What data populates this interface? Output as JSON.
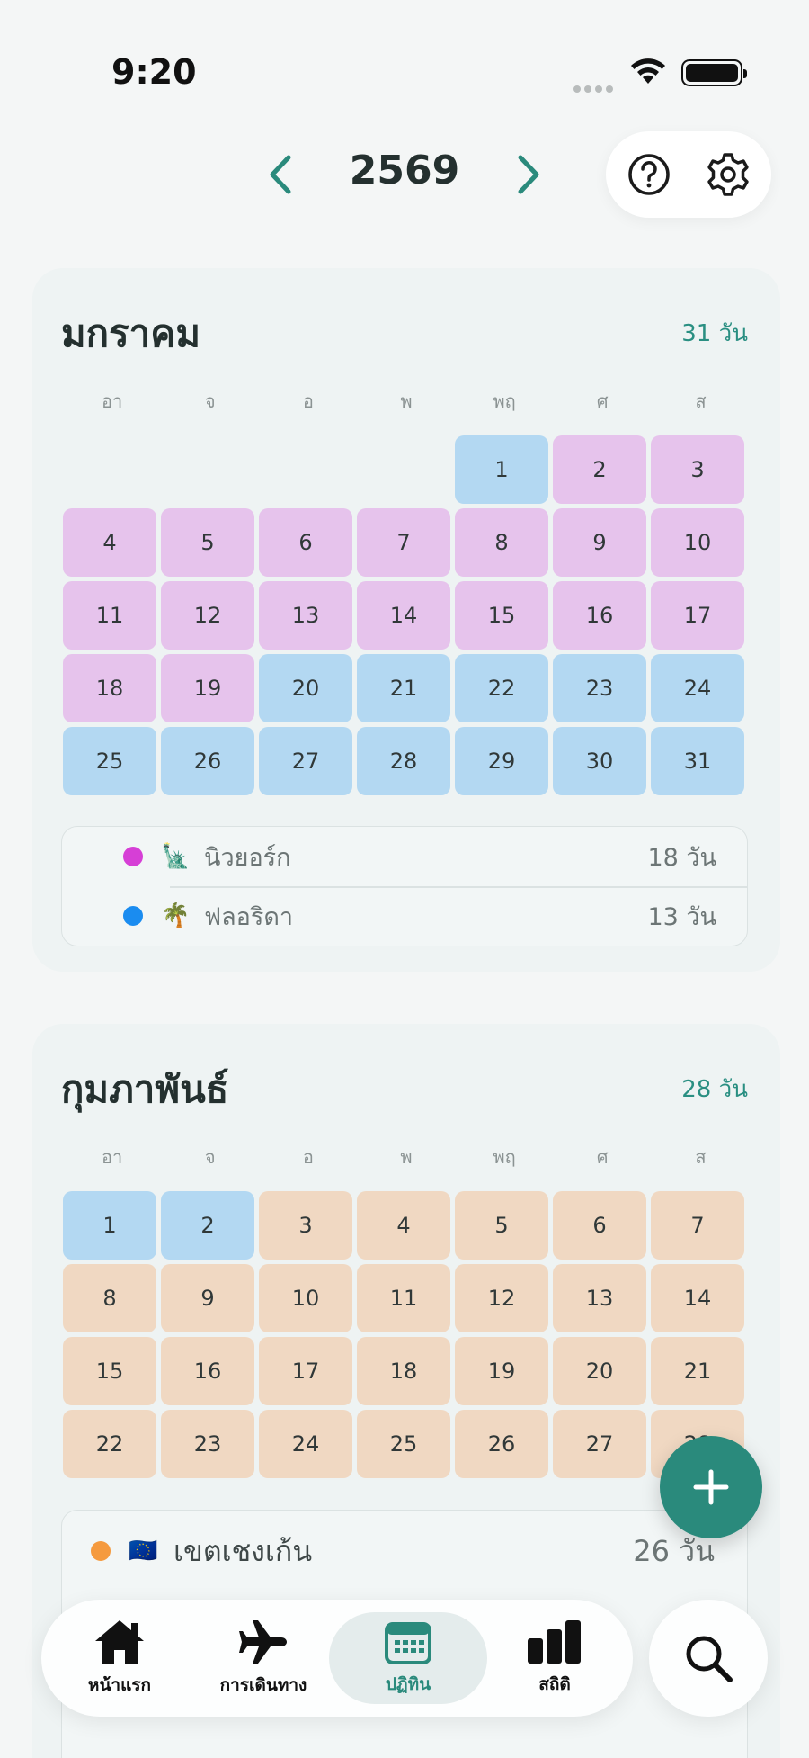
{
  "status_bar": {
    "time": "9:20"
  },
  "header": {
    "year": "2569"
  },
  "colors": {
    "accent": "#2a8a7c",
    "new_york": "#e6c3ec",
    "florida": "#b3d8f2",
    "schengen": "#f0d8c2"
  },
  "weekdays": [
    "อา",
    "จ",
    "อ",
    "พ",
    "พฤ",
    "ศ",
    "ส"
  ],
  "months": [
    {
      "name": "มกราคม",
      "count": "31 วัน",
      "legend": [
        {
          "name": "นิวยอร์ก",
          "emoji": "🗽",
          "days": "18 วัน",
          "dot": "#d63fd6"
        },
        {
          "name": "ฟลอริดา",
          "emoji": "🌴",
          "days": "13 วัน",
          "dot": "#1a8cf0"
        }
      ]
    },
    {
      "name": "กุมภาพันธ์",
      "count": "28 วัน",
      "legend": [
        {
          "name": "เขตเชงเก้น",
          "emoji": "🇪🇺",
          "days": "26 วัน",
          "dot": "#f59a3e"
        }
      ]
    }
  ],
  "nav": {
    "home": "หน้าแรก",
    "trips": "การเดินทาง",
    "calendar": "ปฏิทิน",
    "stats": "สถิติ"
  }
}
